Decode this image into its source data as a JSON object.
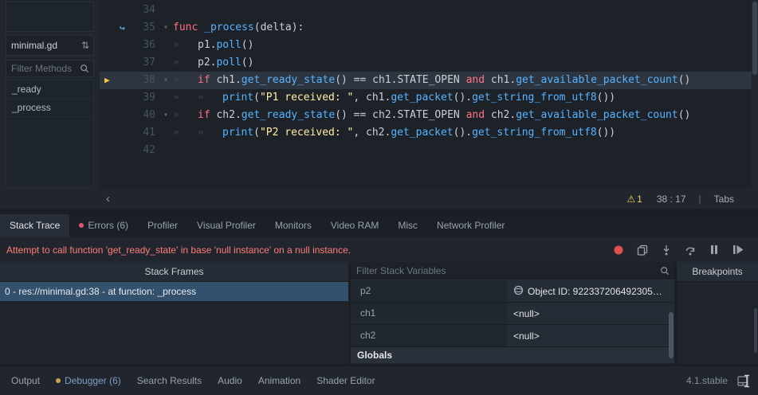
{
  "icons": {
    "fold": "▾",
    "exec_arrow": "▶",
    "override_arrow": "↪",
    "sort": "⇅",
    "prev_script": "‹",
    "warning": "⚠"
  },
  "sidebar": {
    "script_name": "minimal.gd",
    "filter_methods_placeholder": "Filter Methods",
    "methods": [
      "_ready",
      "_process"
    ]
  },
  "editor": {
    "lines": [
      {
        "n": "34",
        "segs": []
      },
      {
        "n": "35",
        "icon": "override",
        "fold": true,
        "segs": [
          [
            "func",
            "kw"
          ],
          [
            " ",
            ""
          ],
          [
            "_process",
            "fn"
          ],
          [
            "(delta):",
            ""
          ]
        ]
      },
      {
        "n": "36",
        "segs": [
          [
            "»",
            "tab"
          ],
          [
            "p1.",
            ""
          ],
          [
            "poll",
            "fn"
          ],
          [
            "()",
            ""
          ]
        ]
      },
      {
        "n": "37",
        "segs": [
          [
            "»",
            "tab"
          ],
          [
            "p2.",
            ""
          ],
          [
            "poll",
            "fn"
          ],
          [
            "()",
            ""
          ]
        ]
      },
      {
        "n": "38",
        "icon": "exec",
        "fold": true,
        "exec": true,
        "segs": [
          [
            "»",
            "tab"
          ],
          [
            "if",
            "kw"
          ],
          [
            " ch1.",
            ""
          ],
          [
            "get_ready_state",
            "fn"
          ],
          [
            "() == ch1.STATE_OPEN ",
            ""
          ],
          [
            "and",
            "kw"
          ],
          [
            " ch1.",
            ""
          ],
          [
            "get_available_packet_count",
            "fn"
          ],
          [
            "()",
            ""
          ]
        ]
      },
      {
        "n": "39",
        "segs": [
          [
            "»",
            "tab"
          ],
          [
            "»",
            "tab"
          ],
          [
            "print",
            "fn"
          ],
          [
            "(",
            ""
          ],
          [
            "\"P1 received: \"",
            "str"
          ],
          [
            ", ch1.",
            ""
          ],
          [
            "get_packet",
            "fn"
          ],
          [
            "().",
            ""
          ],
          [
            "get_string_from_utf8",
            "fn"
          ],
          [
            "())",
            ""
          ]
        ]
      },
      {
        "n": "40",
        "fold": true,
        "segs": [
          [
            "»",
            "tab"
          ],
          [
            "if",
            "kw"
          ],
          [
            " ch2.",
            ""
          ],
          [
            "get_ready_state",
            "fn"
          ],
          [
            "() == ch2.STATE_OPEN ",
            ""
          ],
          [
            "and",
            "kw"
          ],
          [
            " ch2.",
            ""
          ],
          [
            "get_available_packet_count",
            "fn"
          ],
          [
            "()",
            ""
          ]
        ]
      },
      {
        "n": "41",
        "segs": [
          [
            "»",
            "tab"
          ],
          [
            "»",
            "tab"
          ],
          [
            "print",
            "fn"
          ],
          [
            "(",
            ""
          ],
          [
            "\"P2 received: \"",
            "str"
          ],
          [
            ", ch2.",
            ""
          ],
          [
            "get_packet",
            "fn"
          ],
          [
            "().",
            ""
          ],
          [
            "get_string_from_utf8",
            "fn"
          ],
          [
            "())",
            ""
          ]
        ]
      },
      {
        "n": "42",
        "segs": []
      }
    ],
    "status": {
      "warning_count": "1",
      "cursor": "38 : 17",
      "divider": "|",
      "indent": "Tabs"
    }
  },
  "debugger": {
    "tabs": [
      {
        "label": "Stack Trace",
        "active": true
      },
      {
        "label": "Errors (6)",
        "dot": true
      },
      {
        "label": "Profiler"
      },
      {
        "label": "Visual Profiler"
      },
      {
        "label": "Monitors"
      },
      {
        "label": "Video RAM"
      },
      {
        "label": "Misc"
      },
      {
        "label": "Network Profiler"
      }
    ],
    "error_message": "Attempt to call function 'get_ready_state' in base 'null instance' on a null instance.",
    "toolbar": [
      {
        "name": "skip-breakpoints-button",
        "icon": "red-circle"
      },
      {
        "name": "copy-error-button",
        "icon": "copy"
      },
      {
        "name": "step-into-button",
        "icon": "step-into"
      },
      {
        "name": "step-over-button",
        "icon": "step-over"
      },
      {
        "name": "break-button",
        "icon": "pause"
      },
      {
        "name": "continue-button",
        "icon": "continue"
      }
    ],
    "stack_frames_title": "Stack Frames",
    "stack_frames": [
      {
        "label": "0 - res://minimal.gd:38 - at function: _process",
        "selected": true
      }
    ],
    "filter_variables_placeholder": "Filter Stack Variables",
    "variables": [
      {
        "name": "p2",
        "icon": "object",
        "value": "Object ID: 922337206492305…"
      },
      {
        "name": "ch1",
        "value": "<null>"
      },
      {
        "name": "ch2",
        "value": "<null>"
      }
    ],
    "variables_section": "Globals",
    "breakpoints_title": "Breakpoints"
  },
  "statusbar": {
    "items": [
      {
        "label": "Output"
      },
      {
        "label": "Debugger (6)",
        "active": true,
        "dot": true
      },
      {
        "label": "Search Results"
      },
      {
        "label": "Audio"
      },
      {
        "label": "Animation"
      },
      {
        "label": "Shader Editor"
      }
    ],
    "version": "4.1.stable"
  }
}
